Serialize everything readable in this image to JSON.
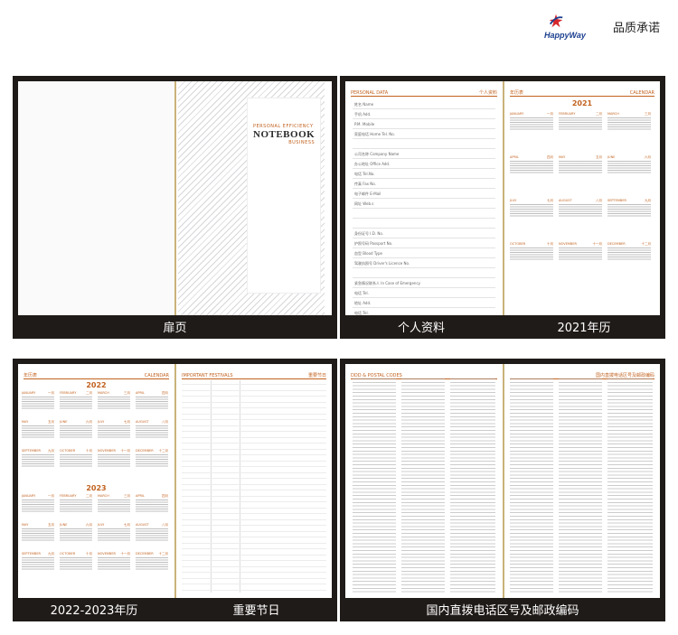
{
  "brand": {
    "name": "HappyWay",
    "slogan": "品质承诺"
  },
  "panels": {
    "title_page": {
      "label": "扉页",
      "cover": {
        "line1": "PERSONAL EFFICIENCY",
        "line2": "NOTEBOOK",
        "line3": "BUSINESS"
      }
    },
    "personal_data": {
      "label": "个人资料",
      "header_left": "PERSONAL DATA",
      "header_right": "个人资料",
      "fields": [
        "姓名 Name",
        "手机 Add.",
        "P.M. Mobile",
        "家庭电话 Home Tel. No.",
        "",
        "公司名称 Company Name",
        "办公地址 Office Add.",
        "电话 Tel.No.",
        "传真 Fax No.",
        "电子邮件 E-Mail",
        "网址 Web.s",
        "",
        "",
        "身份证号 I.D. No.",
        "护照号码 Passport No.",
        "血型 Blood Type",
        "驾驶执照号 Driver's Licence No.",
        "",
        "紧急情况联系人 In Case of Emergency",
        "电话 Tel.",
        "地址 Add.",
        "电话 Tel."
      ]
    },
    "calendar_2021": {
      "label": "2021年历",
      "header_left": "年历表",
      "header_right": "CALENDAR",
      "year": "2021",
      "months": [
        {
          "en": "JANUARY",
          "cn": "一月"
        },
        {
          "en": "FEBRUARY",
          "cn": "二月"
        },
        {
          "en": "MARCH",
          "cn": "三月"
        },
        {
          "en": "APRIL",
          "cn": "四月"
        },
        {
          "en": "MAY",
          "cn": "五月"
        },
        {
          "en": "JUNE",
          "cn": "六月"
        },
        {
          "en": "JULY",
          "cn": "七月"
        },
        {
          "en": "AUGUST",
          "cn": "八月"
        },
        {
          "en": "SEPTEMBER",
          "cn": "九月"
        },
        {
          "en": "OCTOBER",
          "cn": "十月"
        },
        {
          "en": "NOVEMBER",
          "cn": "十一月"
        },
        {
          "en": "DECEMBER",
          "cn": "十二月"
        }
      ]
    },
    "calendar_2022_2023": {
      "label": "2022-2023年历",
      "header_left": "年历表",
      "header_right": "CALENDAR",
      "years": [
        "2022",
        "2023"
      ]
    },
    "festivals": {
      "label": "重要节日",
      "header_left": "IMPORTANT FESTIVALS",
      "header_right": "重要节日"
    },
    "codes": {
      "label": "国内直拨电话区号及邮政编码",
      "header_left": "DDD & POSTAL CODES",
      "header_right": "国内直拨电话区号及邮政编码"
    }
  }
}
